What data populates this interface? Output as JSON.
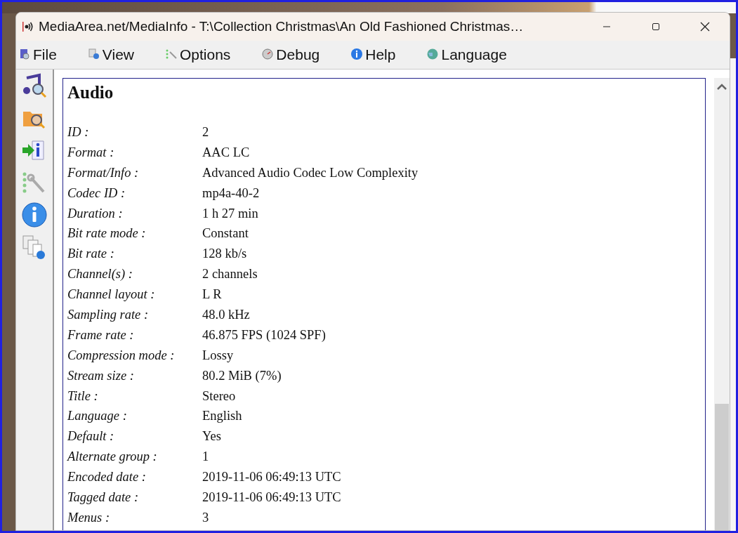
{
  "window": {
    "title": "MediaArea.net/MediaInfo - T:\\Collection Christmas\\An Old Fashioned Christmas…"
  },
  "menu": [
    {
      "label": "File"
    },
    {
      "label": "View"
    },
    {
      "label": "Options"
    },
    {
      "label": "Debug"
    },
    {
      "label": "Help"
    },
    {
      "label": "Language"
    }
  ],
  "toolbar": [
    {
      "kind": "open-file"
    },
    {
      "kind": "open-folder"
    },
    {
      "kind": "export"
    },
    {
      "kind": "preferences"
    },
    {
      "kind": "about"
    },
    {
      "kind": "website"
    }
  ],
  "section": {
    "heading": "Audio",
    "rows": [
      {
        "label": "ID :",
        "value": "2"
      },
      {
        "label": "Format :",
        "value": "AAC LC"
      },
      {
        "label": "Format/Info :",
        "value": "Advanced Audio Codec Low Complexity"
      },
      {
        "label": "Codec ID :",
        "value": "mp4a-40-2"
      },
      {
        "label": "Duration :",
        "value": "1 h 27 min"
      },
      {
        "label": "Bit rate mode :",
        "value": "Constant"
      },
      {
        "label": "Bit rate :",
        "value": "128 kb/s"
      },
      {
        "label": "Channel(s) :",
        "value": "2 channels"
      },
      {
        "label": "Channel layout :",
        "value": "L R"
      },
      {
        "label": "Sampling rate :",
        "value": "48.0 kHz"
      },
      {
        "label": "Frame rate :",
        "value": "46.875 FPS (1024 SPF)"
      },
      {
        "label": "Compression mode :",
        "value": "Lossy"
      },
      {
        "label": "Stream size :",
        "value": "80.2 MiB (7%)"
      },
      {
        "label": "Title :",
        "value": "Stereo"
      },
      {
        "label": "Language :",
        "value": "English"
      },
      {
        "label": "Default :",
        "value": "Yes"
      },
      {
        "label": "Alternate group :",
        "value": "1"
      },
      {
        "label": "Encoded date :",
        "value": "2019-11-06 06:49:13 UTC"
      },
      {
        "label": "Tagged date :",
        "value": "2019-11-06 06:49:13 UTC"
      },
      {
        "label": "Menus :",
        "value": "3"
      }
    ]
  }
}
